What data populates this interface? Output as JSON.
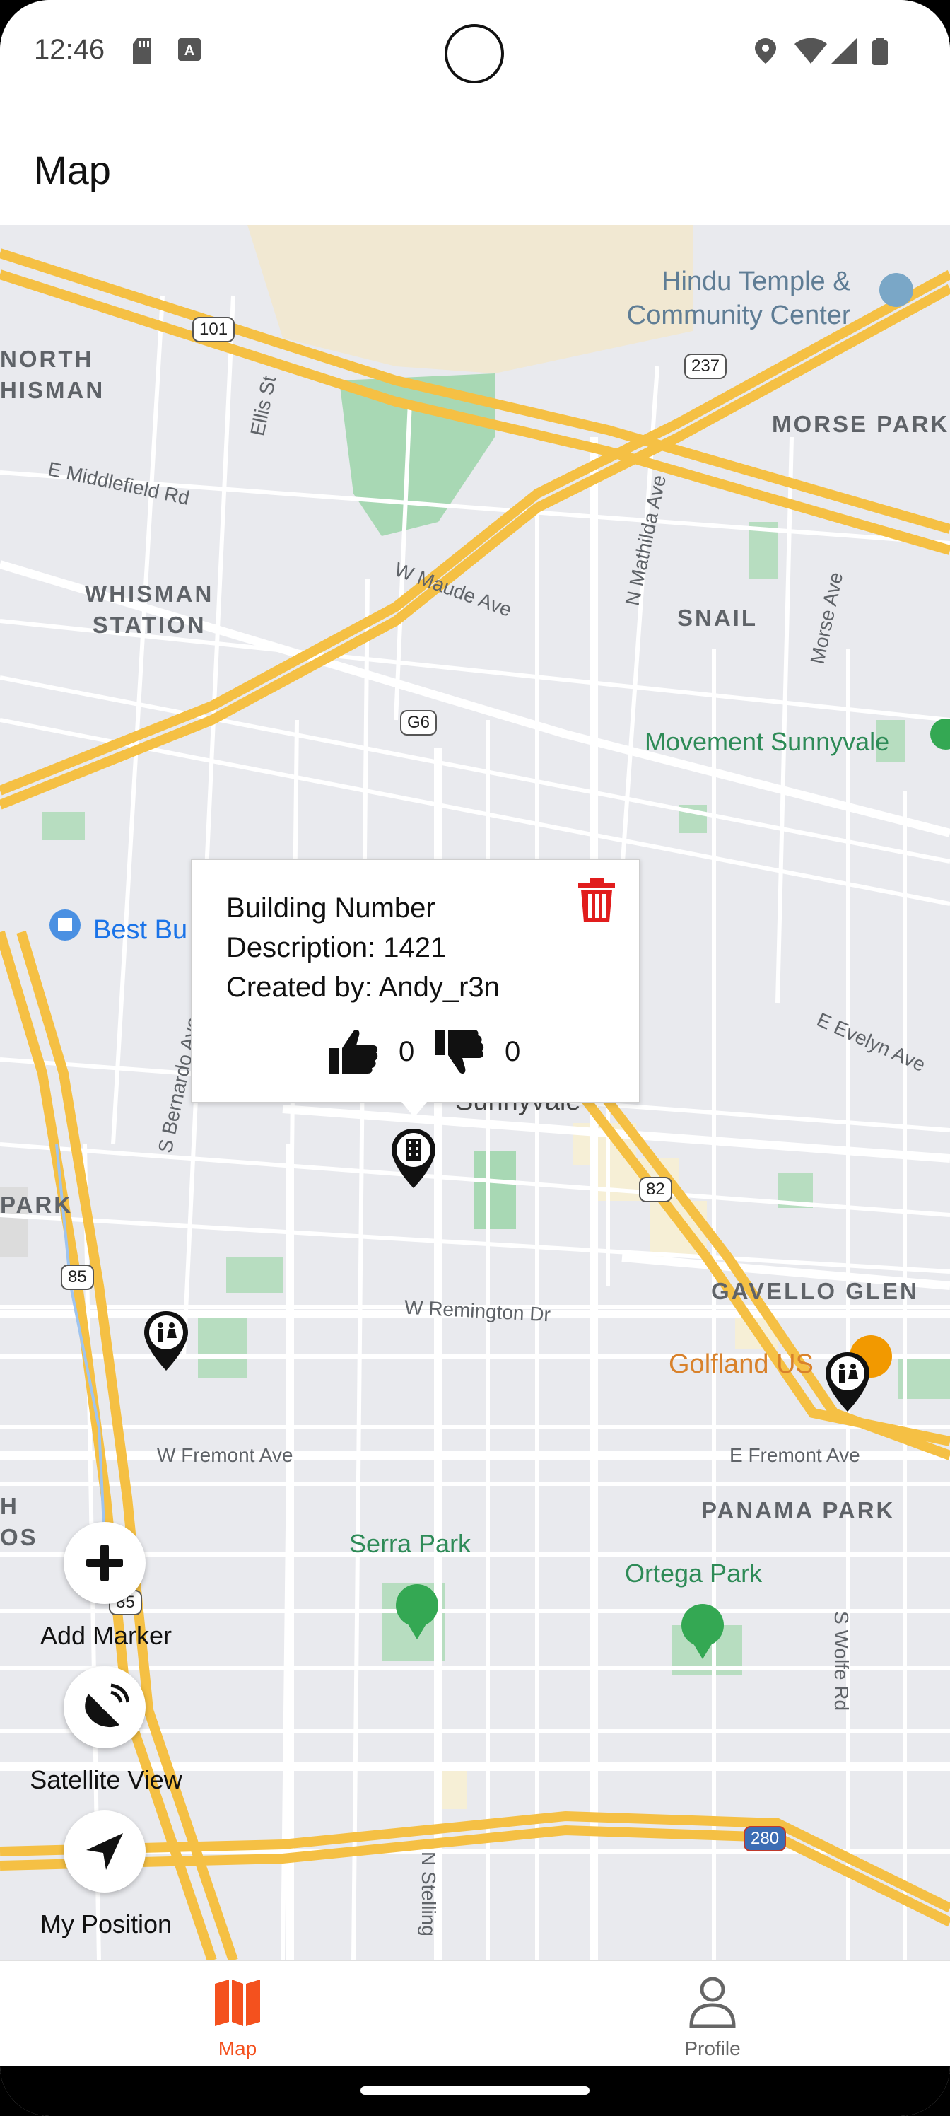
{
  "status_bar": {
    "time": "12:46",
    "icons": [
      "sd-card-icon",
      "keyboard-a-icon",
      "location-icon",
      "wifi-icon",
      "signal-icon",
      "battery-icon"
    ]
  },
  "app_bar": {
    "title": "Map"
  },
  "map": {
    "labels": {
      "hindu_temple_1": "Hindu Temple &",
      "hindu_temple_2": "Community Center",
      "north_whisman_1": "NORTH",
      "north_whisman_2": "HISMAN",
      "morse_park": "MORSE PARK",
      "middlefield": "E Middlefield Rd",
      "ellis": "Ellis St",
      "whisman_station_1": "WHISMAN",
      "whisman_station_2": "STATION",
      "maude": "W Maude Ave",
      "mathilda": "N Mathilda Ave",
      "morse_ave": "Morse Ave",
      "snail": "SNAIL",
      "movement": "Movement Sunnyvale",
      "best_buy": "Best Bu",
      "evelyn": "E Evelyn Ave",
      "bernardo": "S Bernardo Ave",
      "sunnyvale": "Sunnyvale",
      "park_left": "PARK",
      "gavello_glen": "GAVELLO GLEN",
      "remington": "W Remington Dr",
      "golfland": "Golfland US",
      "w_fremont": "W Fremont Ave",
      "e_fremont": "E Fremont Ave",
      "panama_park": "PANAMA PARK",
      "serra_park": "Serra Park",
      "ortega_park": "Ortega Park",
      "wolfe": "S Wolfe Rd",
      "stelling": "N Stelling",
      "h_os_1": "H",
      "h_os_2": "OS"
    },
    "shields": {
      "us101": "101",
      "ca237": "237",
      "g6": "G6",
      "ca82": "82",
      "ca85": "85",
      "ca85b": "85",
      "i280": "280"
    }
  },
  "popup": {
    "title": "Building Number",
    "description": "Description: 1421",
    "created_by": "Created by: Andy_r3n",
    "likes": "0",
    "dislikes": "0"
  },
  "fabs": {
    "add_marker": "Add Marker",
    "satellite_view": "Satellite View",
    "my_position": "My Position"
  },
  "bottom_nav": {
    "items": [
      {
        "label": "Map",
        "icon": "map-icon",
        "active": true
      },
      {
        "label": "Profile",
        "icon": "person-icon",
        "active": false
      }
    ],
    "active_color": "#f4511e",
    "inactive_color": "#666666"
  }
}
